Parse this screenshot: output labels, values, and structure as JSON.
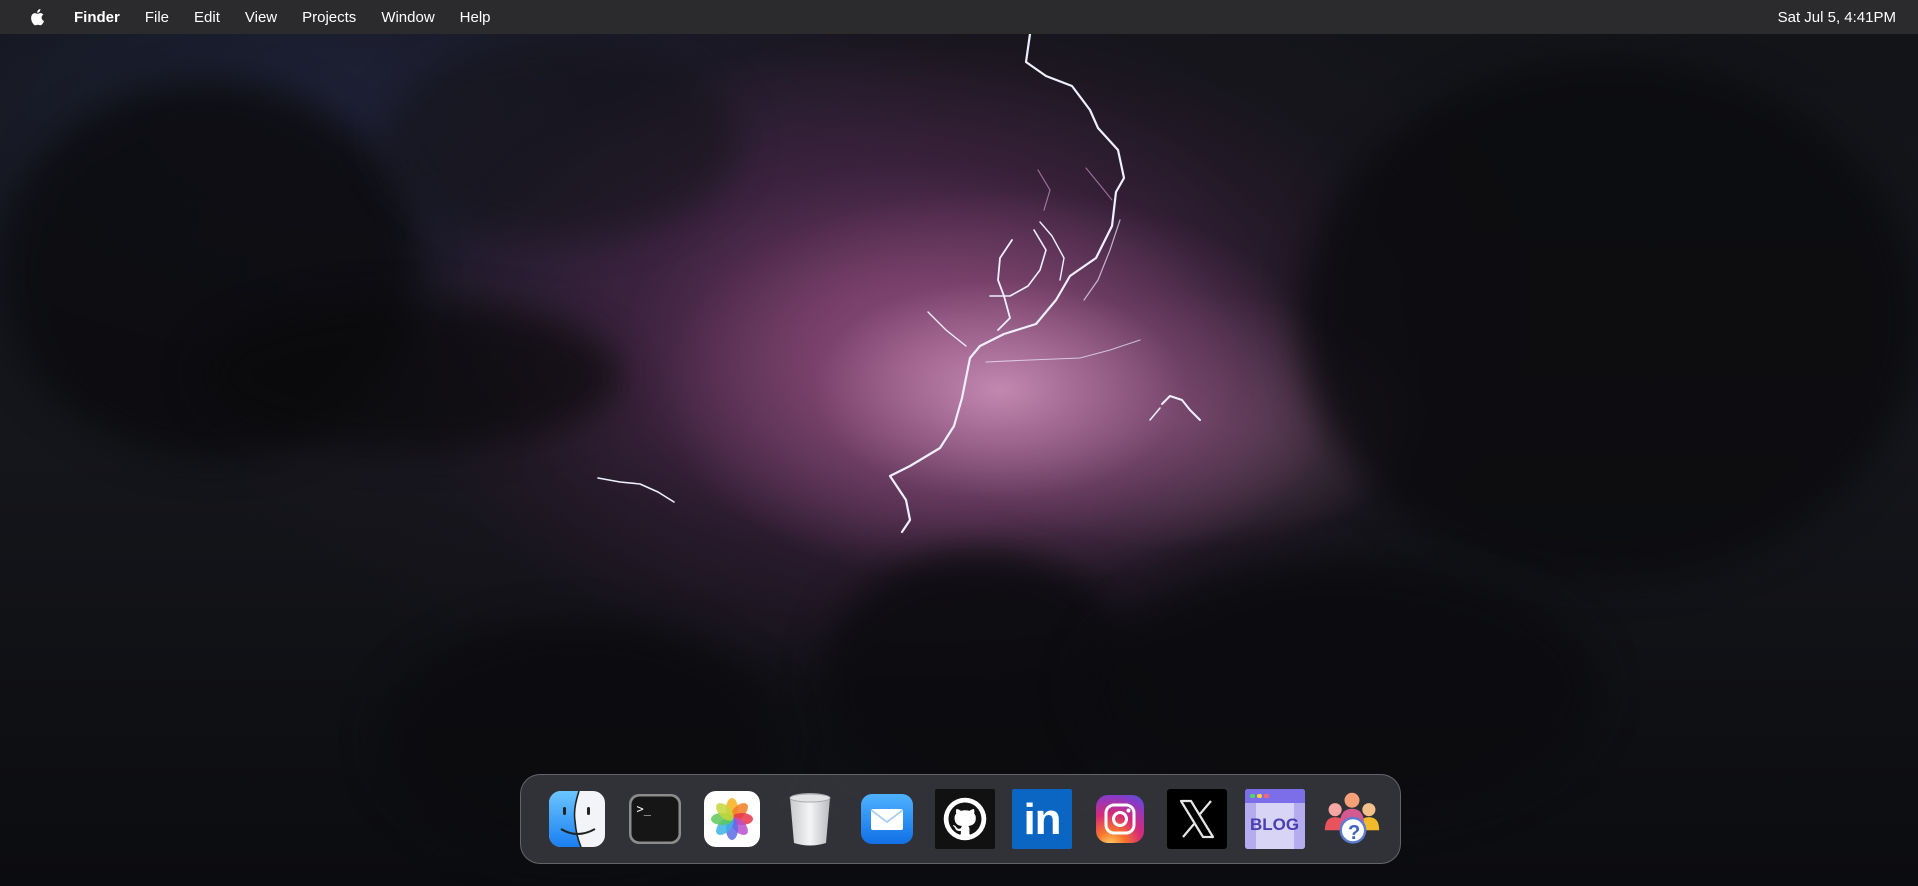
{
  "menubar": {
    "apple_icon": "apple-icon",
    "items": [
      {
        "label": "Finder",
        "bold": true
      },
      {
        "label": "File"
      },
      {
        "label": "Edit"
      },
      {
        "label": "View"
      },
      {
        "label": "Projects"
      },
      {
        "label": "Window"
      },
      {
        "label": "Help"
      }
    ],
    "clock": "Sat Jul 5, 4:41PM"
  },
  "dock": {
    "items": [
      {
        "name": "finder",
        "icon": "finder-icon"
      },
      {
        "name": "terminal",
        "icon": "terminal-icon",
        "prompt": ">_"
      },
      {
        "name": "photos",
        "icon": "photos-icon"
      },
      {
        "name": "trash",
        "icon": "trash-icon"
      },
      {
        "name": "mail",
        "icon": "mail-icon"
      },
      {
        "name": "github",
        "icon": "github-icon"
      },
      {
        "name": "linkedin",
        "icon": "linkedin-icon",
        "text": "in"
      },
      {
        "name": "instagram",
        "icon": "instagram-icon"
      },
      {
        "name": "x",
        "icon": "x-icon"
      },
      {
        "name": "blog",
        "icon": "blog-icon",
        "text": "BLOG"
      },
      {
        "name": "team-help",
        "icon": "team-help-icon",
        "text": "?"
      }
    ]
  },
  "colors": {
    "menubar_bg": "#2b2b2d",
    "dock_bg": "#3c3e42",
    "linkedin": "#0a66c2",
    "mail": "#1e8cf0"
  }
}
